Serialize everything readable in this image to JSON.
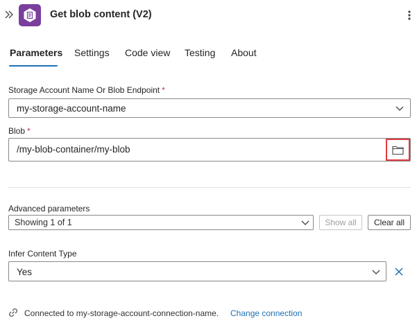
{
  "header": {
    "title": "Get blob content (V2)",
    "collapse_icon": "double-chevron-right-icon",
    "app_icon": "blob-storage-icon",
    "app_icon_color": "#7a3e9d",
    "more_icon": "more-vertical-icon"
  },
  "tabs": [
    {
      "label": "Parameters",
      "active": true
    },
    {
      "label": "Settings",
      "active": false
    },
    {
      "label": "Code view",
      "active": false
    },
    {
      "label": "Testing",
      "active": false
    },
    {
      "label": "About",
      "active": false
    }
  ],
  "storage_account": {
    "label": "Storage Account Name Or Blob Endpoint",
    "required_mark": "*",
    "value": "my-storage-account-name"
  },
  "blob": {
    "label": "Blob",
    "required_mark": "*",
    "value": "/my-blob-container/my-blob",
    "browse_icon": "folder-icon",
    "highlight_color": "#e03a3e"
  },
  "advanced": {
    "label": "Advanced parameters",
    "value": "Showing 1 of 1",
    "show_all_label": "Show all",
    "clear_all_label": "Clear all"
  },
  "infer_content_type": {
    "label": "Infer Content Type",
    "value": "Yes",
    "remove_icon": "close-icon"
  },
  "footer": {
    "connection_icon": "link-icon",
    "connected_text": "Connected to my-storage-account-connection-name.",
    "change_connection_label": "Change connection"
  },
  "colors": {
    "accent": "#1f6fb5",
    "required": "#c4314b"
  }
}
